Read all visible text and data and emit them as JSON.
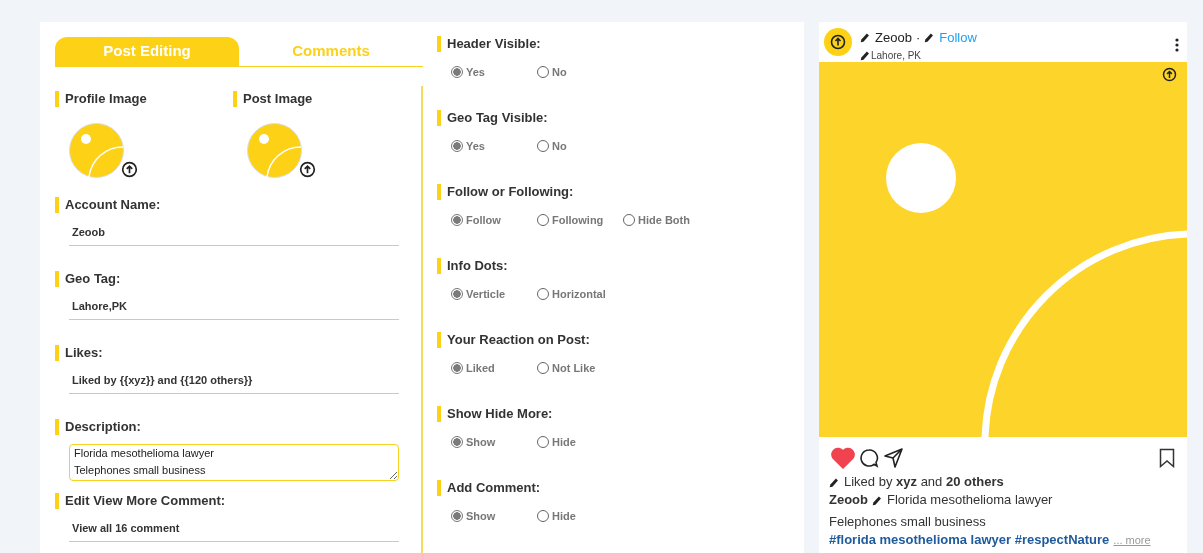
{
  "tabs": [
    {
      "label": "Post Editing",
      "selected": true
    },
    {
      "label": "Comments",
      "selected": false
    }
  ],
  "image_fields": [
    {
      "label": "Profile Image"
    },
    {
      "label": "Post Image"
    }
  ],
  "text_fields": [
    {
      "label": "Account Name:",
      "value": "Zeoob",
      "kind": "line"
    },
    {
      "label": "Geo Tag:",
      "value": "Lahore,PK",
      "kind": "line"
    },
    {
      "label": "Likes:",
      "value": "Liked by {{xyz}} and {{120 others}}",
      "kind": "line"
    },
    {
      "label": "Description:",
      "value": "Florida mesothelioma lawyer\nTelephones small business",
      "kind": "area"
    },
    {
      "label": "Edit View More Comment:",
      "value": "View all 16 comment",
      "kind": "line"
    }
  ],
  "options": [
    {
      "label": "Header Visible:",
      "choices": [
        {
          "label": "Yes",
          "selected": true
        },
        {
          "label": "No",
          "selected": false
        }
      ]
    },
    {
      "label": "Geo Tag Visible:",
      "choices": [
        {
          "label": "Yes",
          "selected": true
        },
        {
          "label": "No",
          "selected": false
        }
      ]
    },
    {
      "label": "Follow or Following:",
      "choices": [
        {
          "label": "Follow",
          "selected": true
        },
        {
          "label": "Following",
          "selected": false
        },
        {
          "label": "Hide Both",
          "selected": false
        }
      ]
    },
    {
      "label": "Info Dots:",
      "choices": [
        {
          "label": "Verticle",
          "selected": true
        },
        {
          "label": "Horizontal",
          "selected": false
        }
      ]
    },
    {
      "label": "Your Reaction on Post:",
      "choices": [
        {
          "label": "Liked",
          "selected": true
        },
        {
          "label": "Not Like",
          "selected": false
        }
      ]
    },
    {
      "label": "Show Hide More:",
      "choices": [
        {
          "label": "Show",
          "selected": true
        },
        {
          "label": "Hide",
          "selected": false
        }
      ]
    },
    {
      "label": "Add Comment:",
      "choices": [
        {
          "label": "Show",
          "selected": true
        },
        {
          "label": "Hide",
          "selected": false
        }
      ]
    }
  ],
  "preview": {
    "username": "Zeoob",
    "separator": "·",
    "follow": "Follow",
    "location": "Lahore, PK",
    "liked": true,
    "likes": "Liked by **xyz** and **20 others**",
    "caption_user": "Zeoob",
    "caption": "Florida mesothelioma lawyer",
    "caption_line2": "Felephones small business",
    "hashtags": "#florida mesothelioma lawyer #respectNature",
    "more": "... more"
  }
}
